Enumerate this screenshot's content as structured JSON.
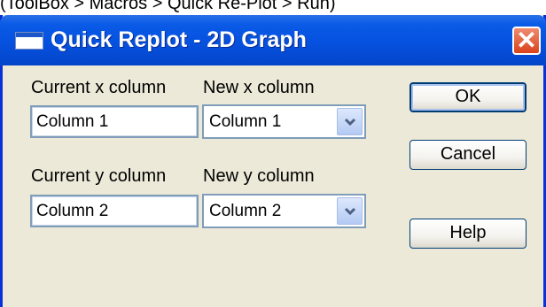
{
  "caption": "(ToolBox > Macros > Quick Re-Plot > Run)",
  "window": {
    "title": "Quick Replot - 2D Graph",
    "close_glyph": "✕"
  },
  "x_row": {
    "current_label": "Current x column",
    "current_value": "Column 1",
    "new_label": "New x column",
    "new_value": "Column 1"
  },
  "y_row": {
    "current_label": "Current y column",
    "current_value": "Column 2",
    "new_label": "New y column",
    "new_value": "Column 2"
  },
  "buttons": {
    "ok": "OK",
    "cancel": "Cancel",
    "help": "Help"
  },
  "colors": {
    "titlebar": "#0651df",
    "dialog_bg": "#ece9d8",
    "close_button": "#d9431c"
  },
  "icons": [
    "app-icon",
    "close-icon",
    "chevron-down-icon"
  ]
}
